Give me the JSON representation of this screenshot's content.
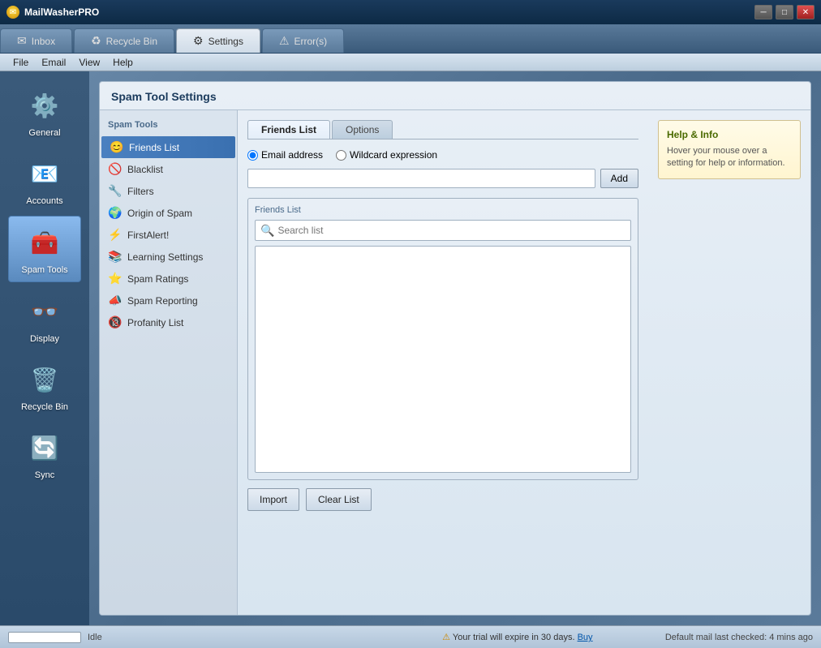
{
  "app": {
    "title": "MailWasherPRO",
    "title_icon": "✉"
  },
  "title_bar": {
    "minimize_label": "─",
    "maximize_label": "□",
    "close_label": "✕"
  },
  "tabs": [
    {
      "id": "inbox",
      "label": "Inbox",
      "icon": "✉",
      "active": false
    },
    {
      "id": "recycle",
      "label": "Recycle Bin",
      "icon": "♻",
      "active": false
    },
    {
      "id": "settings",
      "label": "Settings",
      "icon": "⚙",
      "active": true
    },
    {
      "id": "errors",
      "label": "Error(s)",
      "icon": "⚠",
      "active": false
    }
  ],
  "menu": {
    "items": [
      "File",
      "Email",
      "View",
      "Help"
    ]
  },
  "sidebar": {
    "items": [
      {
        "id": "general",
        "label": "General",
        "icon": "⚙",
        "active": false
      },
      {
        "id": "accounts",
        "label": "Accounts",
        "icon": "📧",
        "active": false
      },
      {
        "id": "spam-tools",
        "label": "Spam Tools",
        "icon": "🧰",
        "active": true
      },
      {
        "id": "display",
        "label": "Display",
        "icon": "👓",
        "active": false
      },
      {
        "id": "recycle-bin",
        "label": "Recycle Bin",
        "icon": "🗑",
        "active": false
      },
      {
        "id": "sync",
        "label": "Sync",
        "icon": "🔄",
        "active": false
      }
    ]
  },
  "settings": {
    "title": "Spam Tool Settings",
    "nav_label": "Spam Tools",
    "nav_items": [
      {
        "id": "friends-list",
        "label": "Friends List",
        "icon": "😊",
        "active": true
      },
      {
        "id": "blacklist",
        "label": "Blacklist",
        "icon": "🚫",
        "active": false
      },
      {
        "id": "filters",
        "label": "Filters",
        "icon": "🔧",
        "active": false
      },
      {
        "id": "origin-of-spam",
        "label": "Origin of Spam",
        "icon": "🌍",
        "active": false
      },
      {
        "id": "firstalert",
        "label": "FirstAlert!",
        "icon": "⚡",
        "active": false
      },
      {
        "id": "learning-settings",
        "label": "Learning Settings",
        "icon": "📚",
        "active": false
      },
      {
        "id": "spam-ratings",
        "label": "Spam Ratings",
        "icon": "⭐",
        "active": false
      },
      {
        "id": "spam-reporting",
        "label": "Spam Reporting",
        "icon": "📣",
        "active": false
      },
      {
        "id": "profanity-list",
        "label": "Profanity List",
        "icon": "🔞",
        "active": false
      }
    ],
    "inner_tabs": [
      {
        "id": "friends-list-tab",
        "label": "Friends List",
        "active": true
      },
      {
        "id": "options-tab",
        "label": "Options",
        "active": false
      }
    ],
    "radio_options": [
      {
        "id": "email-address",
        "label": "Email address",
        "checked": true
      },
      {
        "id": "wildcard-expression",
        "label": "Wildcard expression",
        "checked": false
      }
    ],
    "email_input": {
      "placeholder": "",
      "value": ""
    },
    "add_button": "Add",
    "friends_list_label": "Friends List",
    "search_placeholder": "Search list",
    "import_button": "Import",
    "clear_list_button": "Clear List"
  },
  "help": {
    "title": "Help & Info",
    "text": "Hover your mouse over a setting for help or information."
  },
  "status_bar": {
    "progress_label": "",
    "status_text": "Idle",
    "trial_text": "Your trial will expire in 30 days.",
    "trial_link": "Buy",
    "status_right": "Default mail last checked: 4 mins ago"
  }
}
